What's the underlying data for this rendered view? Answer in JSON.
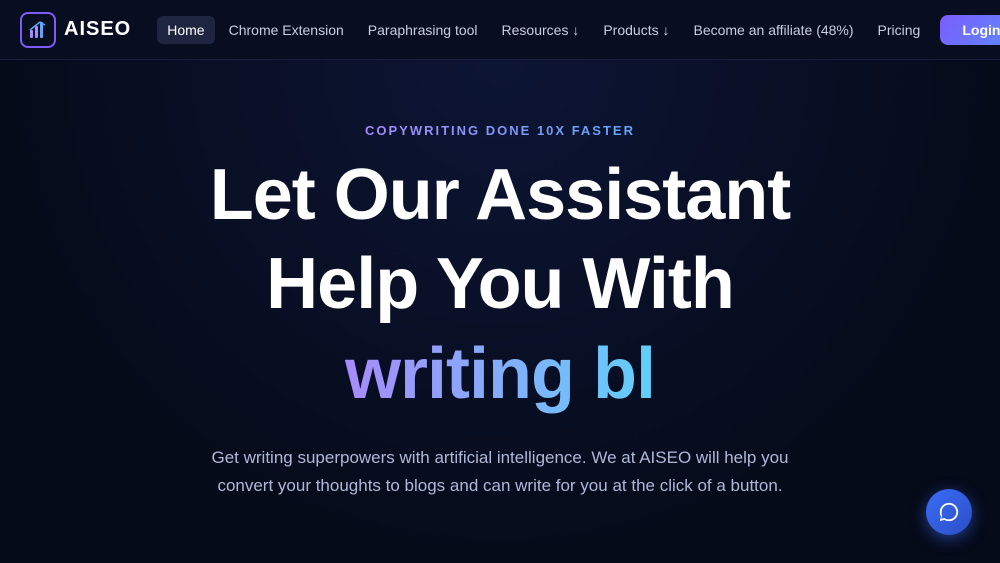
{
  "nav": {
    "logo_text": "AISEO",
    "links": [
      {
        "label": "Home",
        "active": true
      },
      {
        "label": "Chrome Extension",
        "active": false
      },
      {
        "label": "Paraphrasing tool",
        "active": false
      },
      {
        "label": "Resources ↓",
        "active": false
      },
      {
        "label": "Products ↓",
        "active": false
      },
      {
        "label": "Become an affiliate (48%)",
        "active": false
      },
      {
        "label": "Pricing",
        "active": false
      }
    ],
    "login_label": "Login"
  },
  "hero": {
    "tagline": "COPYWRITING DONE 10X FASTER",
    "title_line1": "Let Our Assistant",
    "title_line2": "Help You With",
    "animated_text": "writing bl",
    "description": "Get writing superpowers with artificial intelligence. We at AISEO will help you convert your thoughts to blogs and can write for you at the click of a button."
  }
}
